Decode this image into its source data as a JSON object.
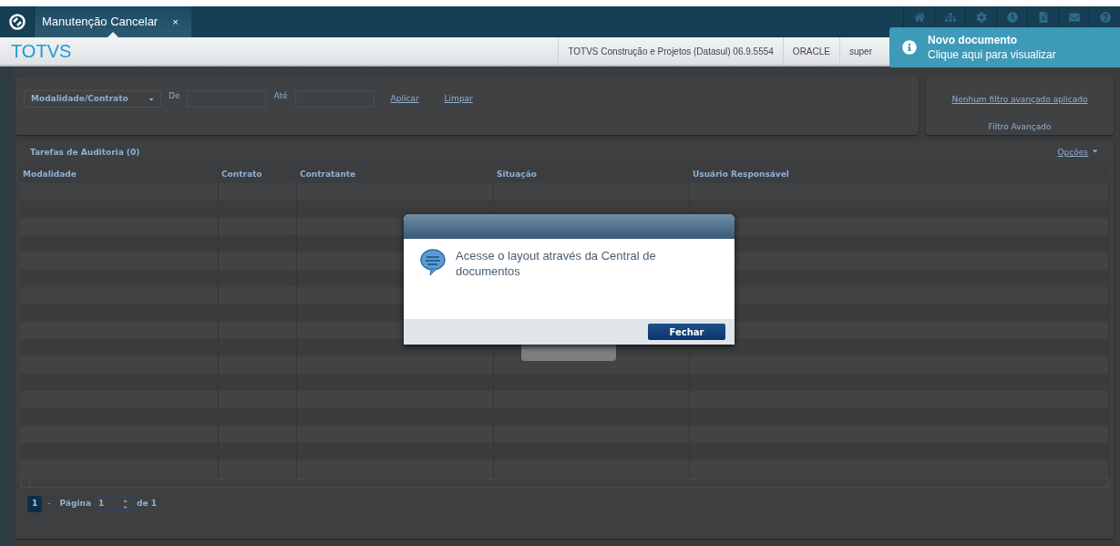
{
  "tabs": [
    {
      "label": "Manutenção Cancelar",
      "close": "×",
      "selected": true
    }
  ],
  "header": {
    "logo": "TOTVS",
    "info": [
      "TOTVS Construção e Projetos (Datasul) 06.9.5554",
      "ORACLE",
      "super"
    ]
  },
  "toast": {
    "title": "Novo documento",
    "message": "Clique aqui para visualizar"
  },
  "filter": {
    "select": "Modalidade/Contrato",
    "from_label": "De",
    "to_label": "Até",
    "apply": "Aplicar",
    "clear": "Limpar"
  },
  "advanced_filter": {
    "link": "Nenhum filtro avançado aplicado",
    "title": "Filtro Avançado"
  },
  "grid": {
    "title": "Tarefas de Auditoria (0)",
    "options": "Opções",
    "columns": [
      "Modalidade",
      "Contrato",
      "Contratante",
      "Situação",
      "Usuário Responsável"
    ]
  },
  "pager": {
    "current": "1",
    "separator": "-",
    "label": "Página",
    "value": "1",
    "of": "de 1"
  },
  "dialog": {
    "message": "Acesse o layout através da Central de documentos",
    "button": "Fechar"
  }
}
